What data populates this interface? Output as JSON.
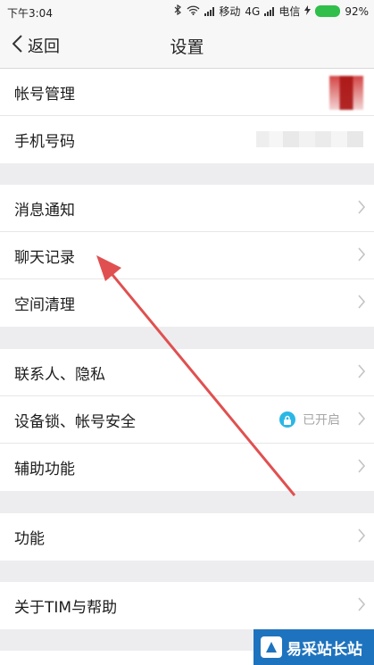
{
  "status_bar": {
    "time": "下午3:04",
    "carrier_1": "移动",
    "network": "4G",
    "carrier_2": "电信",
    "battery_percent": "92%"
  },
  "nav": {
    "back_label": "返回",
    "title": "设置"
  },
  "sections": [
    {
      "items": [
        {
          "label": "帐号管理"
        },
        {
          "label": "手机号码"
        }
      ]
    },
    {
      "items": [
        {
          "label": "消息通知"
        },
        {
          "label": "聊天记录"
        },
        {
          "label": "空间清理"
        }
      ]
    },
    {
      "items": [
        {
          "label": "联系人、隐私"
        },
        {
          "label": "设备锁、帐号安全",
          "status": "已开启"
        },
        {
          "label": "辅助功能"
        }
      ]
    },
    {
      "items": [
        {
          "label": "功能"
        }
      ]
    },
    {
      "items": [
        {
          "label": "关于TIM与帮助"
        }
      ]
    }
  ],
  "watermark": {
    "text": "易采站长站"
  },
  "colors": {
    "accent_arrow": "#e05050",
    "lock_badge": "#2bb7e6",
    "battery": "#2fbf4a",
    "watermark_bg": "#1e73be"
  }
}
